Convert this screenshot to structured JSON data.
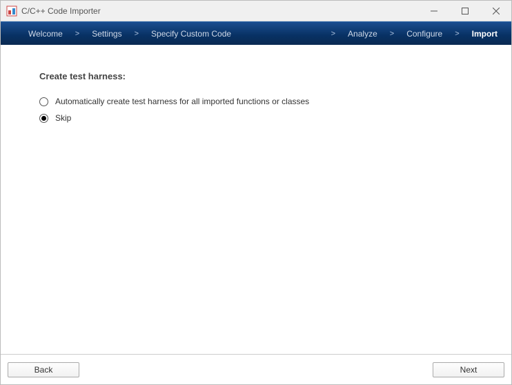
{
  "window": {
    "title": "C/C++ Code Importer"
  },
  "nav": {
    "steps": {
      "welcome": "Welcome",
      "settings": "Settings",
      "specify": "Specify Custom Code",
      "analyze": "Analyze",
      "configure": "Configure",
      "import": "Import"
    },
    "separator": ">"
  },
  "content": {
    "heading": "Create test harness:",
    "options": {
      "auto": "Automatically create test harness for all imported functions or classes",
      "skip": "Skip"
    }
  },
  "footer": {
    "back": "Back",
    "next": "Next"
  }
}
